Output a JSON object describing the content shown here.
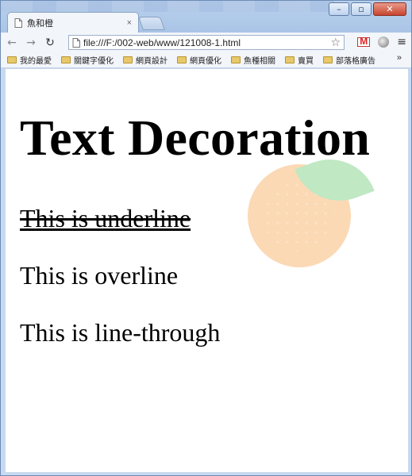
{
  "browser": {
    "tab": {
      "title": "魚和橙",
      "close_glyph": "×"
    },
    "window_controls": {
      "minimize": "–",
      "maximize": "▫",
      "close": "✕"
    },
    "nav": {
      "back": "←",
      "forward": "→",
      "reload": "↻"
    },
    "address_bar": {
      "url": "file:///F:/002-web/www/121008-1.html",
      "star": "☆"
    },
    "menu_glyph": "≡",
    "bookmarks": [
      {
        "label": "我的最愛"
      },
      {
        "label": "關鍵字優化"
      },
      {
        "label": "網頁設計"
      },
      {
        "label": "網頁優化"
      },
      {
        "label": "魚種相關"
      },
      {
        "label": "賣買"
      },
      {
        "label": "部落格廣告"
      }
    ],
    "bookmarks_more": "»"
  },
  "page": {
    "heading": "Text Decoration",
    "lines": [
      {
        "text": "This is underline",
        "decoration": "underline + line-through"
      },
      {
        "text": "This is overline",
        "decoration": "none"
      },
      {
        "text": "This is line-through",
        "decoration": "none"
      }
    ],
    "decor_colors": {
      "orange": "#fbd9b5",
      "leaf": "#bfe8c3"
    }
  }
}
